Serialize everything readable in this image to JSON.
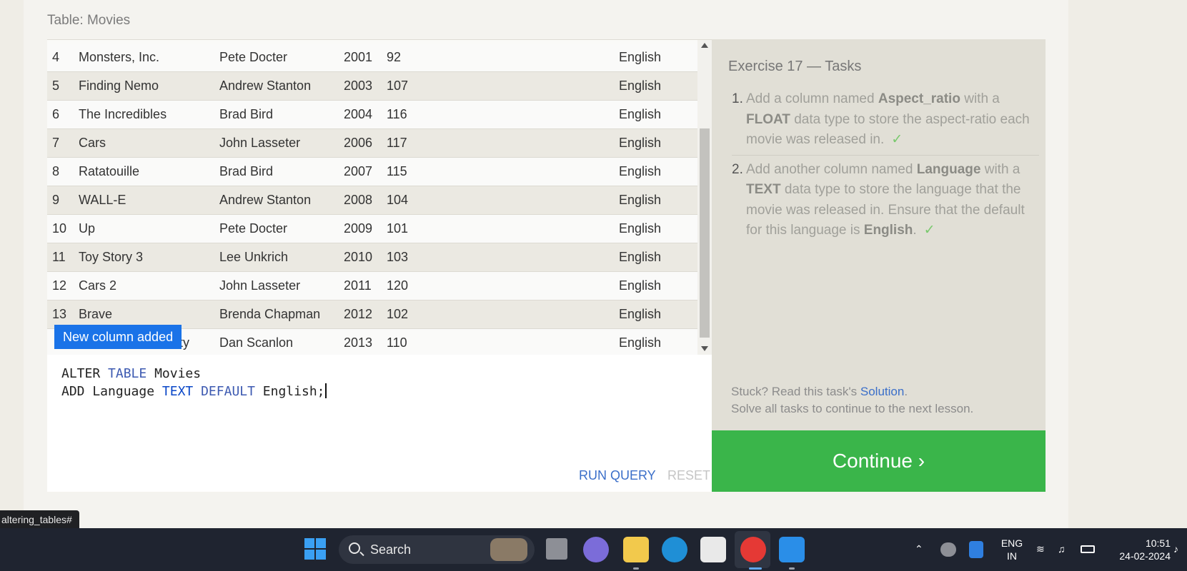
{
  "table": {
    "title": "Table: Movies",
    "rows": [
      {
        "id": "4",
        "title": "Monsters, Inc.",
        "director": "Pete Docter",
        "year": "2001",
        "length": "92",
        "language": "English"
      },
      {
        "id": "5",
        "title": "Finding Nemo",
        "director": "Andrew Stanton",
        "year": "2003",
        "length": "107",
        "language": "English"
      },
      {
        "id": "6",
        "title": "The Incredibles",
        "director": "Brad Bird",
        "year": "2004",
        "length": "116",
        "language": "English"
      },
      {
        "id": "7",
        "title": "Cars",
        "director": "John Lasseter",
        "year": "2006",
        "length": "117",
        "language": "English"
      },
      {
        "id": "8",
        "title": "Ratatouille",
        "director": "Brad Bird",
        "year": "2007",
        "length": "115",
        "language": "English"
      },
      {
        "id": "9",
        "title": "WALL-E",
        "director": "Andrew Stanton",
        "year": "2008",
        "length": "104",
        "language": "English"
      },
      {
        "id": "10",
        "title": "Up",
        "director": "Pete Docter",
        "year": "2009",
        "length": "101",
        "language": "English"
      },
      {
        "id": "11",
        "title": "Toy Story 3",
        "director": "Lee Unkrich",
        "year": "2010",
        "length": "103",
        "language": "English"
      },
      {
        "id": "12",
        "title": "Cars 2",
        "director": "John Lasseter",
        "year": "2011",
        "length": "120",
        "language": "English"
      },
      {
        "id": "13",
        "title": "Brave",
        "director": "Brenda Chapman",
        "year": "2012",
        "length": "102",
        "language": "English"
      },
      {
        "id": "",
        "title": "ty",
        "director": "Dan Scanlon",
        "year": "2013",
        "length": "110",
        "language": "English"
      }
    ]
  },
  "toast": "New column added",
  "editor": {
    "line1": [
      "ALTER",
      "TABLE",
      "Movies"
    ],
    "line2": [
      "ADD Language",
      "TEXT",
      "DEFAULT",
      "English;"
    ],
    "run_label": "RUN QUERY",
    "reset_label": "RESET"
  },
  "exercise": {
    "title": "Exercise 17 — Tasks",
    "task1": {
      "num": "1.",
      "pre": "Add a column named ",
      "name": "Aspect_ratio",
      "mid": " with a ",
      "type": "FLOAT",
      "post": " data type to store the aspect-ratio each movie was released in.",
      "check": "✓"
    },
    "task2": {
      "num": "2.",
      "pre": "Add another column named ",
      "name": "Language",
      "mid": " with a ",
      "type": "TEXT",
      "post": " data type to store the language that the movie was released in. Ensure that the default for this language is ",
      "default": "English",
      "end": ".",
      "check": "✓"
    },
    "stuck_pre": "Stuck? Read this task's ",
    "solution_link": "Solution",
    "stuck_post": ".",
    "solve_all": "Solve all tasks to continue to the next lesson."
  },
  "continue_label": "Continue ›",
  "status_url": "altering_tables#",
  "taskbar": {
    "search_placeholder": "Search",
    "lang_line1": "ENG",
    "lang_line2": "IN",
    "time": "10:51",
    "date": "24-02-2024"
  },
  "colors": {
    "continue": "#3ab54a",
    "toast": "#1a73e8",
    "link": "#3b6fc9",
    "check": "#79c96d"
  }
}
